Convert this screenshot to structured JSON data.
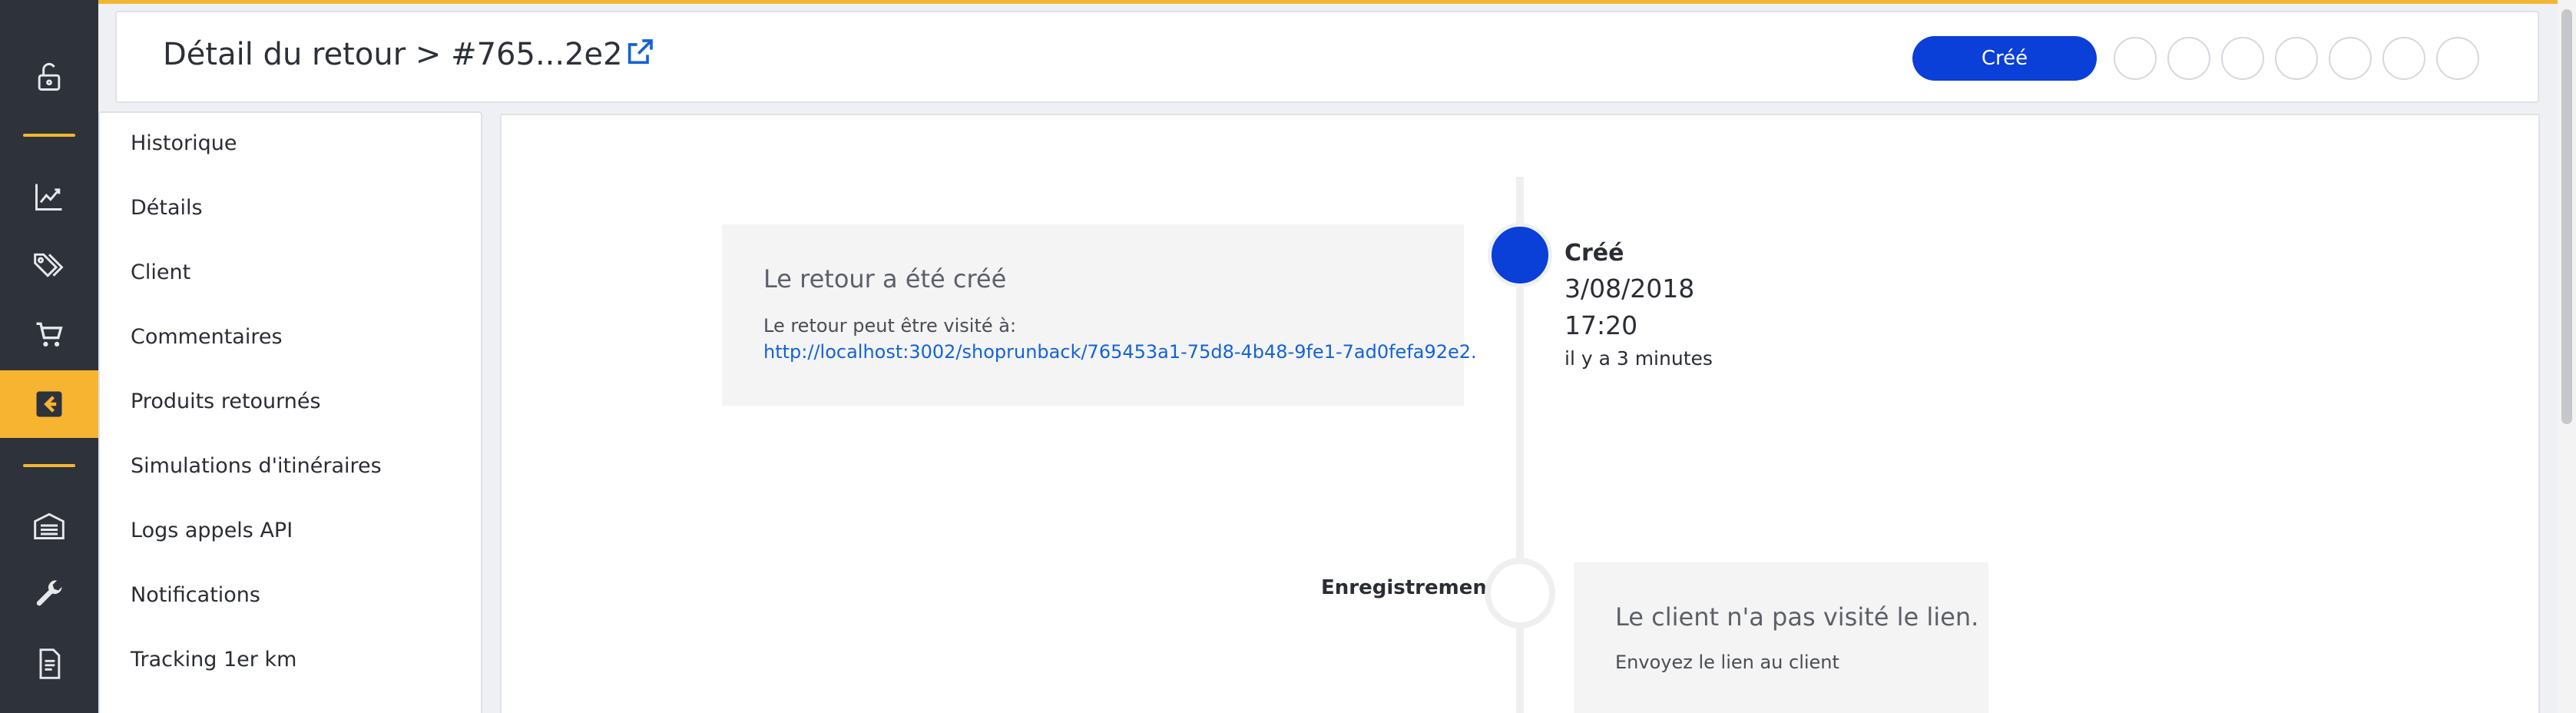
{
  "header": {
    "title": "Détail du retour > #765...2e2",
    "status_steps": {
      "current_label": "Créé",
      "pending_count_visible": 7
    }
  },
  "nav": {
    "icons": [
      "lock-open-icon",
      "chart-line-icon",
      "tags-icon",
      "cart-icon",
      "return-arrow-icon",
      "warehouse-icon",
      "wrench-icon",
      "document-icon"
    ],
    "active": "return-arrow-icon",
    "accent_color": "#f2b631"
  },
  "sidemenu": {
    "items": [
      "Historique",
      "Détails",
      "Client",
      "Commentaires",
      "Produits retournés",
      "Simulations d'itinéraires",
      "Logs appels API",
      "Notifications",
      "Tracking 1er km"
    ]
  },
  "timeline": {
    "created_card": {
      "title": "Le retour a été créé",
      "text": "Le retour peut être visité à:",
      "link": "http://localhost:3002/shoprunback/765453a1-75d8-4b48-9fe1-7ad0fefa92e2."
    },
    "created_event": {
      "title": "Créé",
      "date": "3/08/2018",
      "time": "17:20",
      "ago": "il y a 3 minutes"
    },
    "registration_event": {
      "label": "Enregistrement"
    },
    "registration_card": {
      "title": "Le client n'a pas visité le lien.",
      "text": "Envoyez le lien au client"
    }
  },
  "colors": {
    "primary": "#0a3fd8",
    "link": "#1463d6",
    "nav_bg": "#2e323b"
  }
}
